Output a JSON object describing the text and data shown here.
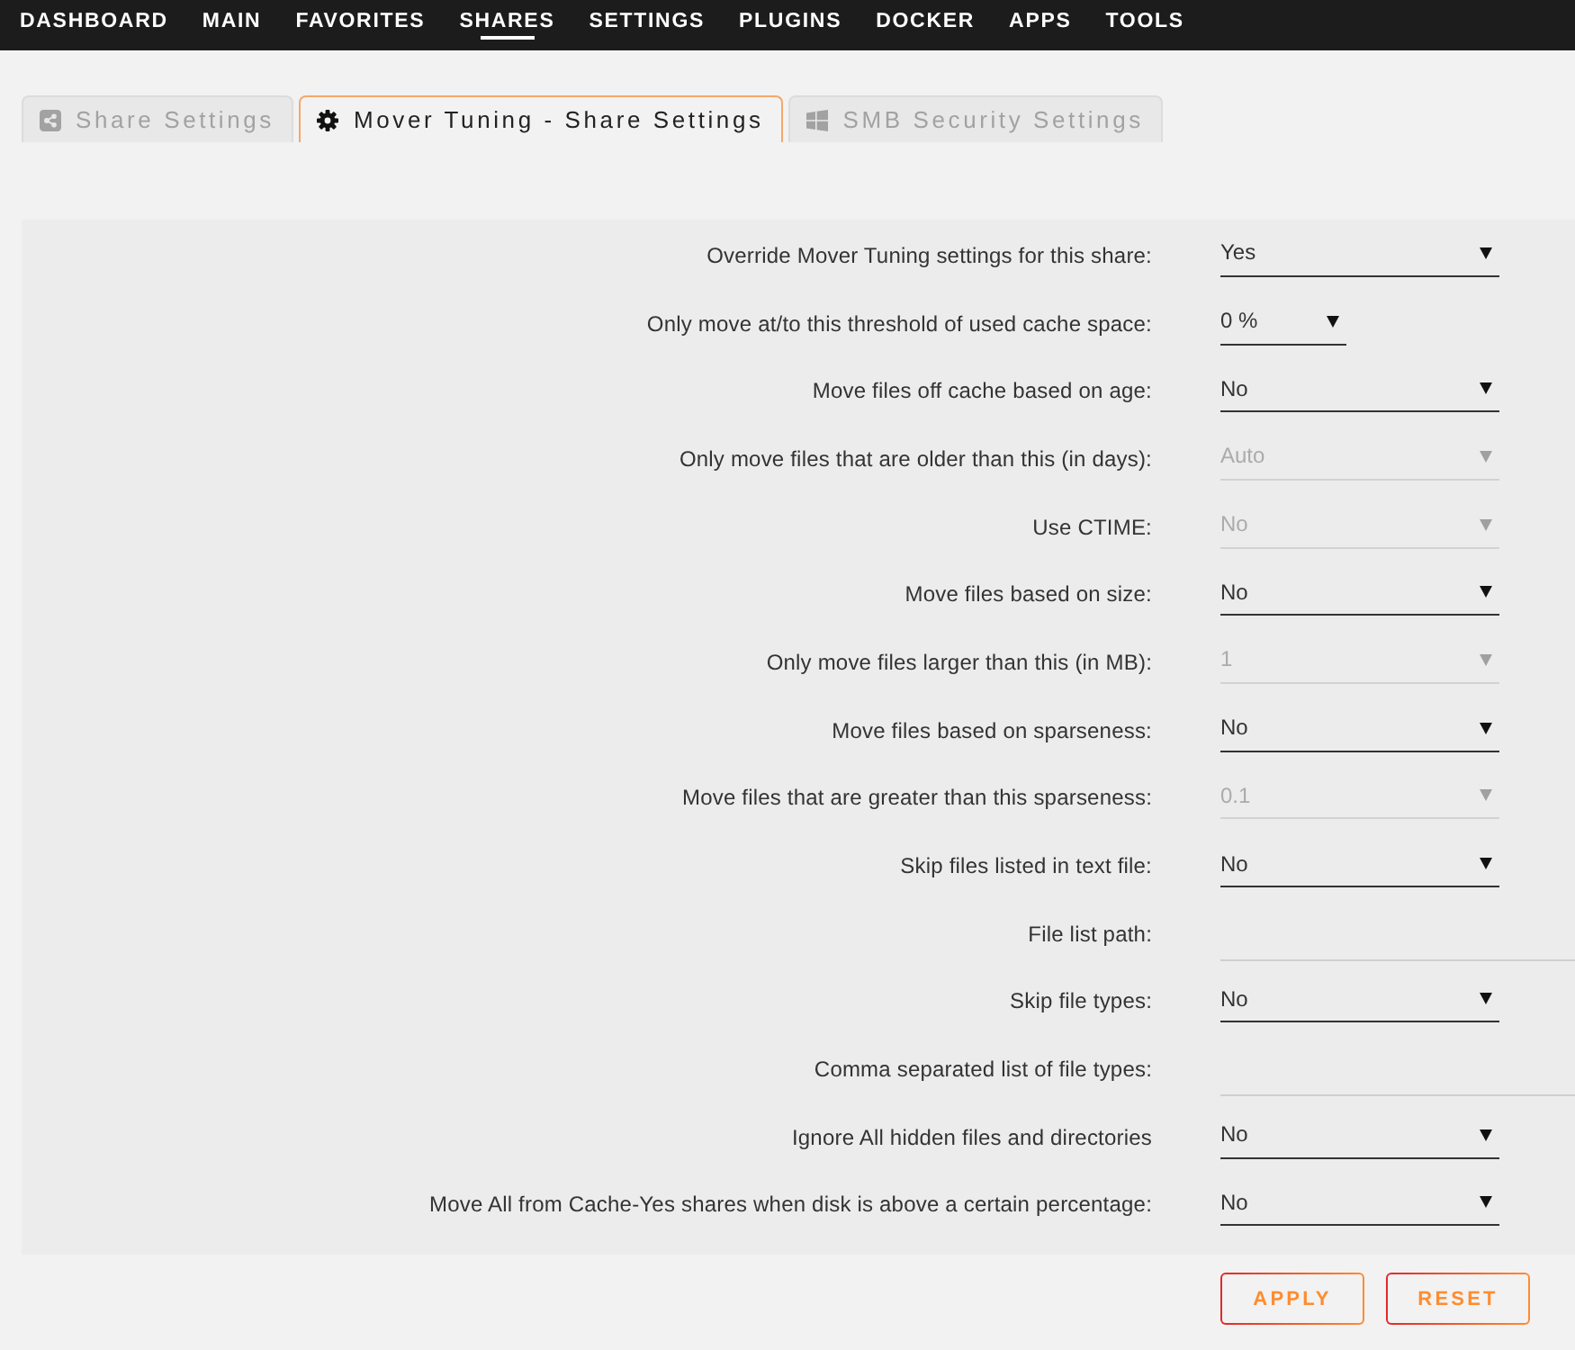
{
  "nav": [
    {
      "label": "DASHBOARD",
      "selected": false
    },
    {
      "label": "MAIN",
      "selected": false
    },
    {
      "label": "FAVORITES",
      "selected": false
    },
    {
      "label": "SHARES",
      "selected": true
    },
    {
      "label": "SETTINGS",
      "selected": false
    },
    {
      "label": "PLUGINS",
      "selected": false
    },
    {
      "label": "DOCKER",
      "selected": false
    },
    {
      "label": "APPS",
      "selected": false
    },
    {
      "label": "TOOLS",
      "selected": false
    }
  ],
  "tabs": [
    {
      "label": "Share Settings",
      "selected": false
    },
    {
      "label": "Mover Tuning - Share Settings",
      "selected": true
    },
    {
      "label": "SMB Security Settings",
      "selected": false
    }
  ],
  "fields": [
    {
      "kind": "select",
      "label": "Override Mover Tuning settings for this share:",
      "value": "Yes",
      "disabled": false
    },
    {
      "kind": "narrow",
      "label": "Only move at/to this threshold of used cache space:",
      "value": "0 %",
      "disabled": false
    },
    {
      "kind": "select",
      "label": "Move files off cache based on age:",
      "value": "No",
      "disabled": false
    },
    {
      "kind": "select",
      "label": "Only move files that are older than this (in days):",
      "value": "Auto",
      "disabled": true
    },
    {
      "kind": "select",
      "label": "Use CTIME:",
      "value": "No",
      "disabled": true
    },
    {
      "kind": "select",
      "label": "Move files based on size:",
      "value": "No",
      "disabled": false
    },
    {
      "kind": "select",
      "label": "Only move files larger than this (in MB):",
      "value": "1",
      "disabled": true
    },
    {
      "kind": "select",
      "label": "Move files based on sparseness:",
      "value": "No",
      "disabled": false
    },
    {
      "kind": "select",
      "label": "Move files that are greater than this sparseness:",
      "value": "0.1",
      "disabled": true
    },
    {
      "kind": "select",
      "label": "Skip files listed in text file:",
      "value": "No",
      "disabled": false
    },
    {
      "kind": "text",
      "label": "File list path:"
    },
    {
      "kind": "select",
      "label": "Skip file types:",
      "value": "No",
      "disabled": false
    },
    {
      "kind": "text",
      "label": "Comma separated list of file types:"
    },
    {
      "kind": "select",
      "label": "Ignore All hidden files and directories",
      "value": "No",
      "disabled": false
    },
    {
      "kind": "select",
      "label": "Move All from Cache-Yes shares when disk is above a certain percentage:",
      "value": "No",
      "disabled": false
    }
  ],
  "buttons": [
    {
      "label": "APPLY"
    },
    {
      "label": "RESET"
    }
  ]
}
